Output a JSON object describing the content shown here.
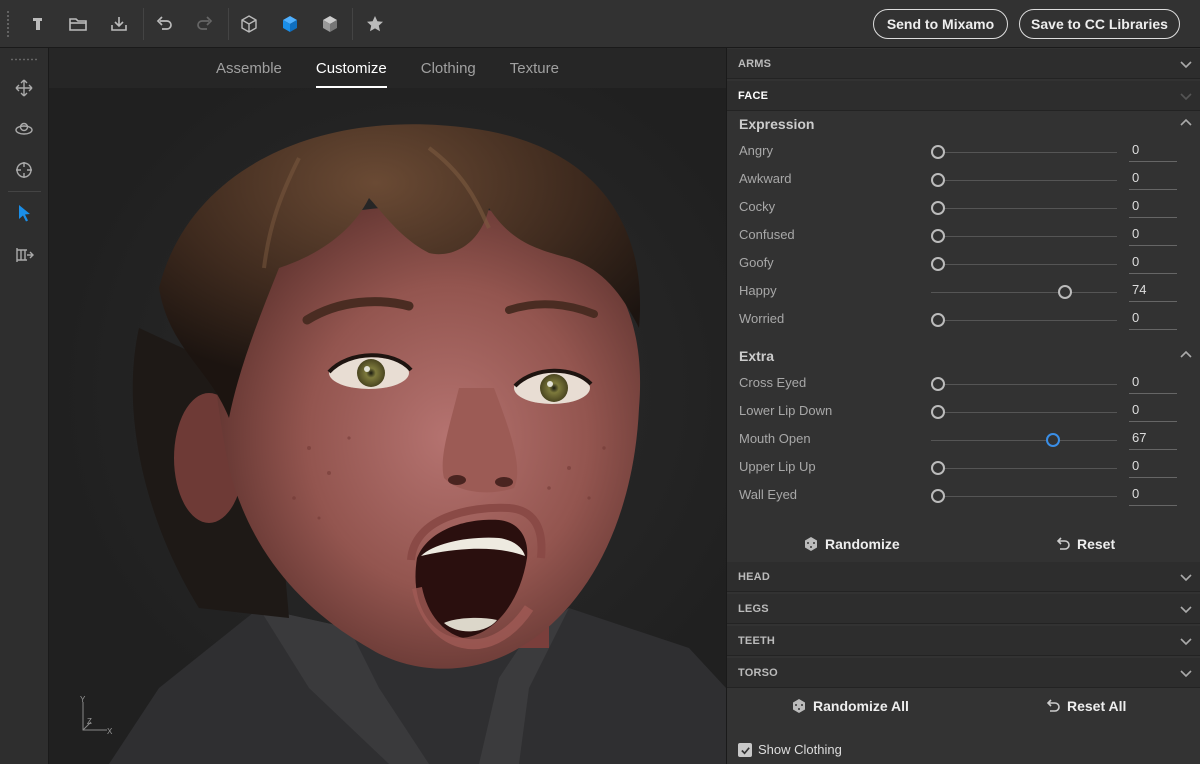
{
  "toolbar": {
    "icons": [
      "new-icon",
      "open-folder-icon",
      "import-icon",
      "undo-icon",
      "redo-icon",
      "cube-outline-icon",
      "cube-blue-icon",
      "cube-gray-icon",
      "star-icon"
    ],
    "send_label": "Send to Mixamo",
    "save_label": "Save to CC Libraries",
    "accent": "#1a8ee8"
  },
  "rail": {
    "icons": [
      "move-icon",
      "orbit-icon",
      "target-icon",
      "pointer-icon",
      "export-pose-icon"
    ]
  },
  "viewport": {
    "tabs": [
      {
        "label": "Assemble",
        "active": false
      },
      {
        "label": "Customize",
        "active": true
      },
      {
        "label": "Clothing",
        "active": false
      },
      {
        "label": "Texture",
        "active": false
      }
    ],
    "axis": {
      "y": "Y",
      "z": "Z",
      "x": "X"
    }
  },
  "panel": {
    "arms": "ARMS",
    "face": "FACE",
    "expression": {
      "title": "Expression",
      "sliders": [
        {
          "label": "Angry",
          "value": 0
        },
        {
          "label": "Awkward",
          "value": 0
        },
        {
          "label": "Cocky",
          "value": 0
        },
        {
          "label": "Confused",
          "value": 0
        },
        {
          "label": "Goofy",
          "value": 0
        },
        {
          "label": "Happy",
          "value": 74
        },
        {
          "label": "Worried",
          "value": 0
        }
      ]
    },
    "extra": {
      "title": "Extra",
      "sliders": [
        {
          "label": "Cross Eyed",
          "value": 0
        },
        {
          "label": "Lower Lip Down",
          "value": 0
        },
        {
          "label": "Mouth Open",
          "value": 67
        },
        {
          "label": "Upper Lip Up",
          "value": 0
        },
        {
          "label": "Wall Eyed",
          "value": 0
        }
      ]
    },
    "randomize": "Randomize",
    "reset": "Reset",
    "head": "HEAD",
    "legs": "LEGS",
    "teeth": "TEETH",
    "torso": "TORSO",
    "randomize_all": "Randomize All",
    "reset_all": "Reset All",
    "show_clothing": "Show Clothing",
    "show_clothing_checked": true
  }
}
